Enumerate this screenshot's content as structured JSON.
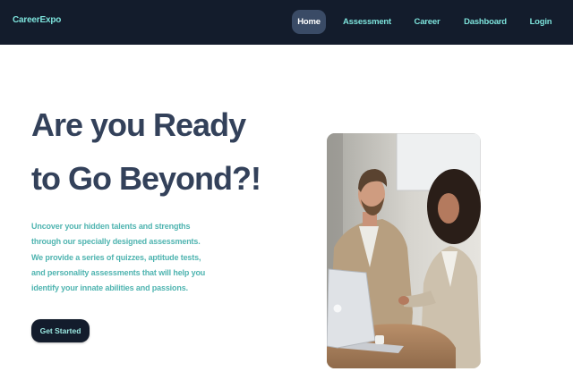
{
  "brand": "CareerExpo",
  "nav": {
    "home": "Home",
    "assessment": "Assessment",
    "career": "Career",
    "dashboard": "Dashboard",
    "login": "Login"
  },
  "hero": {
    "title_lines": [
      "Are you Ready",
      "to Go Beyond?!"
    ],
    "description_lines": [
      "Uncover your hidden talents and strengths",
      "through our specially designed assessments.",
      "We provide a series of quizzes, aptitude tests,",
      "and personality assessments that will help you",
      "identify your innate abilities and passions."
    ],
    "cta": "Get Started"
  },
  "colors": {
    "navbar_bg": "#131c2c",
    "accent_teal": "#7de3dc",
    "title": "#33415a",
    "description": "#4fb4b0",
    "active_tab_bg": "#3a4b66"
  }
}
